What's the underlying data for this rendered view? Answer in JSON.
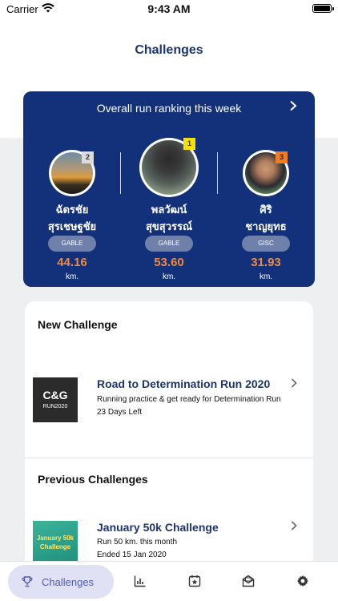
{
  "status_bar": {
    "carrier": "Carrier",
    "time": "9:43 AM"
  },
  "header": {
    "title": "Challenges"
  },
  "ranking": {
    "title": "Overall run ranking this week",
    "runners": [
      {
        "rank": "2",
        "name_line1": "ฉัตรชัย",
        "name_line2": "สุรเชษฐชัย",
        "team": "GABLE",
        "distance": "44.16",
        "unit": "km."
      },
      {
        "rank": "1",
        "name_line1": "พลวัฒน์",
        "name_line2": "สุขสุวรรณ์",
        "team": "GABLE",
        "distance": "53.60",
        "unit": "km."
      },
      {
        "rank": "3",
        "name_line1": "ศิริ",
        "name_line2": "ชาญยุทธ",
        "team": "GISC",
        "distance": "31.93",
        "unit": "km."
      }
    ],
    "colors": {
      "card": "#13307a",
      "rank1": "#f5e100",
      "rank2": "#dcdcdc",
      "rank3": "#f07d20",
      "distance": "#f08a3c"
    }
  },
  "new_challenge": {
    "section_title": "New Challenge",
    "items": [
      {
        "thumb_line1": "C&G",
        "thumb_line2": "RUN2020",
        "title": "Road to Determination Run 2020",
        "desc1": "Running practice & get ready for Determination Run",
        "desc2": "23 Days Left"
      }
    ]
  },
  "previous_challenges": {
    "section_title": "Previous Challenges",
    "items": [
      {
        "thumb_line1": "January 50k",
        "thumb_line2": "Challenge",
        "title": "January 50k Challenge",
        "desc1": "Run 50 km. this month",
        "desc2": "Ended 15 Jan 2020"
      }
    ]
  },
  "tabbar": {
    "active_label": "Challenges",
    "icons": [
      "trophy-icon",
      "bar-chart-icon",
      "star-calendar-icon",
      "mail-icon",
      "gear-icon"
    ]
  }
}
